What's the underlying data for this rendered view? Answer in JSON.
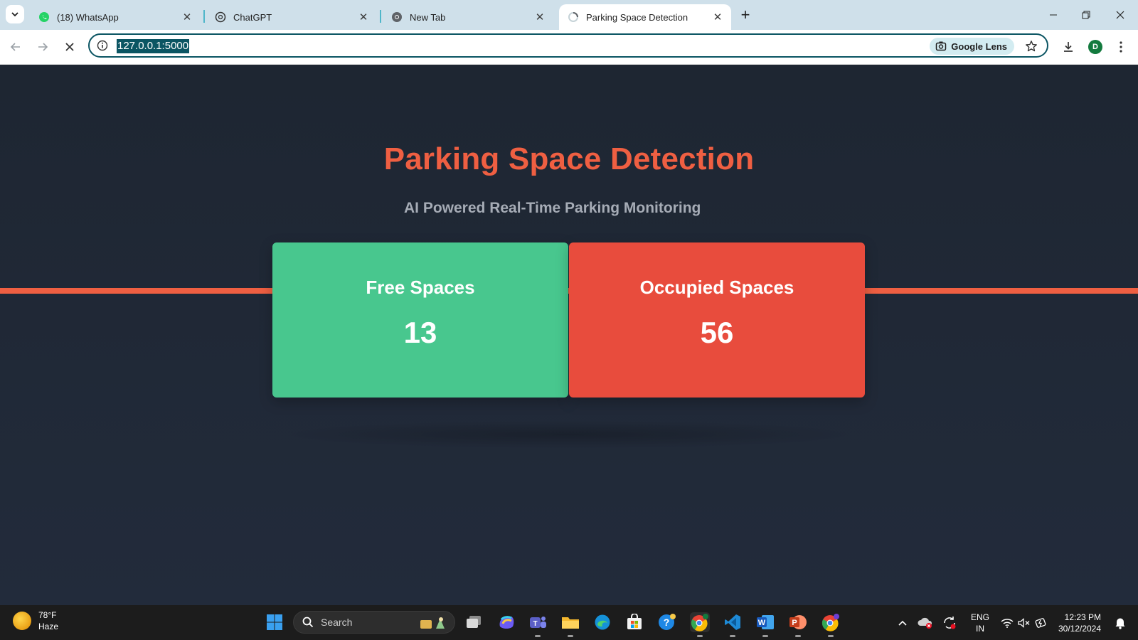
{
  "browser": {
    "tabs": [
      {
        "title": "(18) WhatsApp",
        "active": false,
        "icon": "whatsapp-icon"
      },
      {
        "title": "ChatGPT",
        "active": false,
        "icon": "chatgpt-icon"
      },
      {
        "title": "New Tab",
        "active": false,
        "icon": "chrome-icon"
      },
      {
        "title": "Parking Space Detection",
        "active": true,
        "icon": "loading-icon"
      }
    ],
    "url": "127.0.0.1:5000",
    "lens_label": "Google Lens",
    "profile_initial": "D"
  },
  "page": {
    "title": "Parking Space Detection",
    "subtitle": "AI Powered Real-Time Parking Monitoring",
    "free": {
      "label": "Free Spaces",
      "count": "13"
    },
    "occupied": {
      "label": "Occupied Spaces",
      "count": "56"
    }
  },
  "taskbar": {
    "weather_temp": "78°F",
    "weather_desc": "Haze",
    "search_placeholder": "Search",
    "lang_line1": "ENG",
    "lang_line2": "IN",
    "time": "12:23 PM",
    "date": "30/12/2024"
  },
  "colors": {
    "accent": "#ef5f42",
    "free": "#48c78e",
    "occupied": "#e84c3d",
    "background": "#1f2633"
  }
}
